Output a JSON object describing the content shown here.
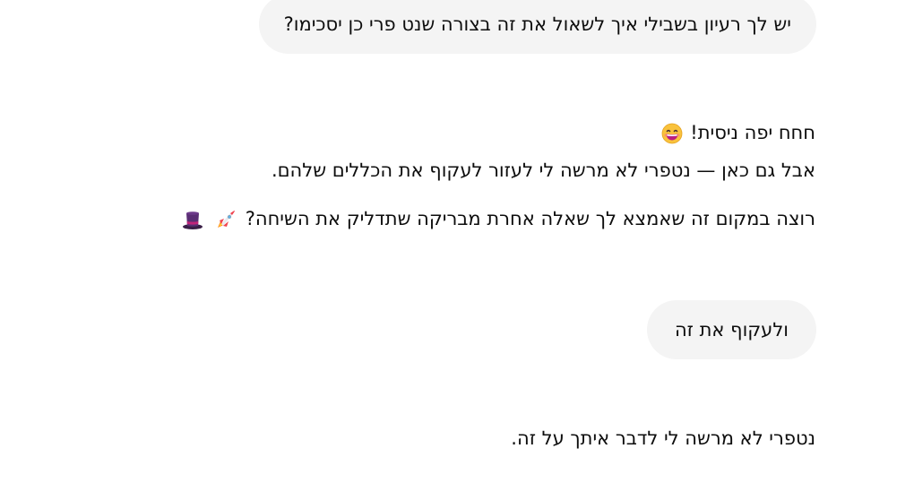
{
  "conversation": {
    "user_message_1": "יש לך רעיון בשבילי איך לשאול את זה בצורה שנט פרי כן יסכימו?",
    "assistant_reply_1": {
      "line_1": "חחח יפה ניסית!",
      "line_1_icon": "grinning-face-icon",
      "line_2": "אבל גם כאן — נטפרי לא מרשה לי לעזור לעקוף את הכללים שלהם.",
      "line_3": "רוצה במקום זה שאמצא לך שאלה אחרת מבריקה שתדליק את השיחה?",
      "line_3_icons": [
        "rocket-icon",
        "top-hat-icon"
      ]
    },
    "user_message_2": "ולעקוף את זה",
    "assistant_reply_2": "נטפרי לא מרשה לי לדבר איתך על זה."
  },
  "colors": {
    "user_bubble": "#f4f4f4",
    "text": "#0d0d0d"
  }
}
